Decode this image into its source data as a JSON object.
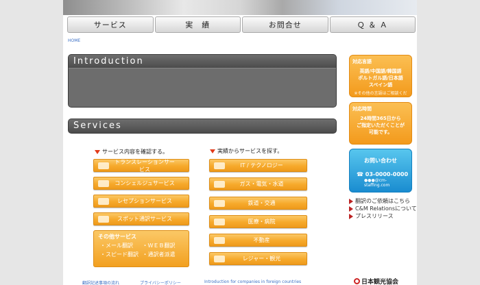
{
  "nav": [
    {
      "label": "サービス"
    },
    {
      "label": "実　績"
    },
    {
      "label": "お問合せ"
    },
    {
      "label": "Ｑ ＆ Ａ"
    }
  ],
  "breadcrumb": "HOME",
  "intro": {
    "title": "Introduction"
  },
  "services": {
    "title": "Services",
    "left_heading": "サービス内容を確認する。",
    "right_heading": "実績からサービスを探す。",
    "left_buttons": [
      {
        "label": "トランスレーションサービス",
        "icon": "group-icon"
      },
      {
        "label": "コンシェルジュサービス",
        "icon": "concierge-icon"
      },
      {
        "label": "レセプションサービス",
        "icon": "reception-icon"
      },
      {
        "label": "スポット通訳サービス",
        "icon": "meeting-icon"
      }
    ],
    "other": {
      "title": "その他サービス",
      "items": [
        "・メール翻訳",
        "・ＷＥＢ翻訳",
        "・スピード翻訳",
        "・通訳者派遣"
      ]
    },
    "right_buttons": [
      {
        "label": "IT / テクノロジー",
        "icon": "computer-icon"
      },
      {
        "label": "ガス・電気・水道",
        "icon": "lightbulb-icon"
      },
      {
        "label": "鉄道・交通",
        "icon": "train-icon"
      },
      {
        "label": "医療・病院",
        "icon": "medical-icon"
      },
      {
        "label": "不動産",
        "icon": "building-icon"
      },
      {
        "label": "レジャー・観光",
        "icon": "leisure-icon"
      }
    ]
  },
  "sidebar": {
    "languages": {
      "heading": "対応言語",
      "lines": [
        "英語/中国語/韓国語",
        "ポルトガル語/日本語",
        "スペイン語"
      ],
      "note": "※その他の言語はご相談ください。"
    },
    "hours": {
      "heading": "対応時間",
      "lines": [
        "24時間365日から",
        "ご指定いただくことが",
        "可能です。"
      ]
    },
    "contact": {
      "heading": "お問い合わせ",
      "phone": "03-0000-0000",
      "email": "●●●@cm-staffing.com"
    },
    "links": [
      "翻訳のご依頼はこちら",
      "C&M Relationsについて",
      "プレスリリース"
    ],
    "association": "日本観光協会"
  },
  "footer_links": [
    "翻訳記述事項の流れ",
    "プライバシーポリシー",
    "Introduction for companies in foreign countries"
  ]
}
